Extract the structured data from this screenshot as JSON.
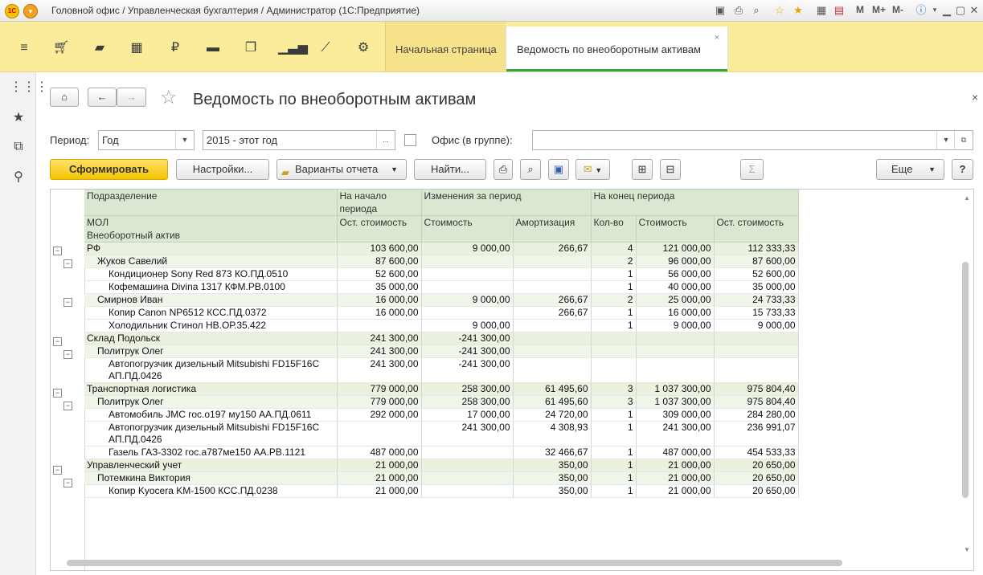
{
  "window": {
    "title": "Головной офис / Управленческая бухгалтерия / Администратор  (1С:Предприятие)",
    "logo_text": "1С",
    "m_labels": [
      "M",
      "M+",
      "M-"
    ]
  },
  "tabs": {
    "home": "Начальная страница",
    "active": "Ведомость по внеоборотным активам",
    "close": "×"
  },
  "page": {
    "title": "Ведомость по внеоборотным активам",
    "close": "×"
  },
  "filters": {
    "period_label": "Период:",
    "period_type": "Год",
    "period_value": "2015 - этот год",
    "period_more": "...",
    "office_label": "Офис (в группе):",
    "office_value": ""
  },
  "toolbar": {
    "generate": "Сформировать",
    "settings": "Настройки...",
    "variants": "Варианты отчета",
    "find": "Найти...",
    "more": "Еще",
    "help": "?",
    "sum": "Σ"
  },
  "table": {
    "headers": {
      "division": "Подразделение",
      "mol": "МОЛ",
      "asset": "Внеоборотный актив",
      "start": "На начало периода",
      "changes": "Изменения за период",
      "end": "На конец периода",
      "start_residual": "Ост. стоимость",
      "change_cost": "Стоимость",
      "change_amort": "Амортизация",
      "end_qty": "Кол-во",
      "end_cost": "Стоимость",
      "end_residual": "Ост. стоимость"
    },
    "rows": [
      {
        "level": 0,
        "name": "РФ",
        "start": "103 600,00",
        "cost": "9 000,00",
        "amort": "266,67",
        "qty": "4",
        "end_cost": "121 000,00",
        "end_res": "112 333,33"
      },
      {
        "level": 1,
        "name": "Жуков Савелий",
        "start": "87 600,00",
        "cost": "",
        "amort": "",
        "qty": "2",
        "end_cost": "96 000,00",
        "end_res": "87 600,00"
      },
      {
        "level": 2,
        "name": "Кондиционер Sony Red 873 КО.ПД.0510",
        "start": "52 600,00",
        "cost": "",
        "amort": "",
        "qty": "1",
        "end_cost": "56 000,00",
        "end_res": "52 600,00"
      },
      {
        "level": 2,
        "name": "Кофемашина Divina 1317 КФМ.РВ.0100",
        "start": "35 000,00",
        "cost": "",
        "amort": "",
        "qty": "1",
        "end_cost": "40 000,00",
        "end_res": "35 000,00"
      },
      {
        "level": 1,
        "name": "Смирнов Иван",
        "start": "16 000,00",
        "cost": "9 000,00",
        "amort": "266,67",
        "qty": "2",
        "end_cost": "25 000,00",
        "end_res": "24 733,33"
      },
      {
        "level": 2,
        "name": "Копир Canon NP6512 КСС.ПД.0372",
        "start": "16 000,00",
        "cost": "",
        "amort": "266,67",
        "qty": "1",
        "end_cost": "16 000,00",
        "end_res": "15 733,33"
      },
      {
        "level": 2,
        "name": "Холодильник Стинол НВ.ОР.35.422",
        "start": "",
        "cost": "9 000,00",
        "amort": "",
        "qty": "1",
        "end_cost": "9 000,00",
        "end_res": "9 000,00"
      },
      {
        "level": 0,
        "name": "Склад Подольск",
        "start": "241 300,00",
        "cost": "-241 300,00",
        "amort": "",
        "qty": "",
        "end_cost": "",
        "end_res": ""
      },
      {
        "level": 1,
        "name": "Политрук Олег",
        "start": "241 300,00",
        "cost": "-241 300,00",
        "amort": "",
        "qty": "",
        "end_cost": "",
        "end_res": ""
      },
      {
        "level": 2,
        "name": "Автопогрузчик дизельный Mitsubishi FD15F16C",
        "name2": "АП.ПД.0426",
        "start": "241 300,00",
        "cost": "-241 300,00",
        "amort": "",
        "qty": "",
        "end_cost": "",
        "end_res": ""
      },
      {
        "level": 0,
        "name": "Транспортная логистика",
        "start": "779 000,00",
        "cost": "258 300,00",
        "amort": "61 495,60",
        "qty": "3",
        "end_cost": "1 037 300,00",
        "end_res": "975 804,40"
      },
      {
        "level": 1,
        "name": "Политрук Олег",
        "start": "779 000,00",
        "cost": "258 300,00",
        "amort": "61 495,60",
        "qty": "3",
        "end_cost": "1 037 300,00",
        "end_res": "975 804,40"
      },
      {
        "level": 2,
        "name": "Автомобиль JMC гос.о197 му150 АА.ПД.0611",
        "start": "292 000,00",
        "cost": "17 000,00",
        "amort": "24 720,00",
        "qty": "1",
        "end_cost": "309 000,00",
        "end_res": "284 280,00"
      },
      {
        "level": 2,
        "name": "Автопогрузчик дизельный Mitsubishi FD15F16C",
        "name2": "АП.ПД.0426",
        "start": "",
        "cost": "241 300,00",
        "amort": "4 308,93",
        "qty": "1",
        "end_cost": "241 300,00",
        "end_res": "236 991,07"
      },
      {
        "level": 2,
        "name": "Газель ГАЗ-3302 гос.а787ме150 АА.РВ.1121",
        "start": "487 000,00",
        "cost": "",
        "amort": "32 466,67",
        "qty": "1",
        "end_cost": "487 000,00",
        "end_res": "454 533,33"
      },
      {
        "level": 0,
        "name": "Управленческий учет",
        "start": "21 000,00",
        "cost": "",
        "amort": "350,00",
        "qty": "1",
        "end_cost": "21 000,00",
        "end_res": "20 650,00"
      },
      {
        "level": 1,
        "name": "Потемкина Виктория",
        "start": "21 000,00",
        "cost": "",
        "amort": "350,00",
        "qty": "1",
        "end_cost": "21 000,00",
        "end_res": "20 650,00"
      },
      {
        "level": 2,
        "name": "Копир Kyocera KM-1500 КСС.ПД.0238",
        "start": "21 000,00",
        "cost": "",
        "amort": "350,00",
        "qty": "1",
        "end_cost": "21 000,00",
        "end_res": "20 650,00"
      }
    ]
  }
}
